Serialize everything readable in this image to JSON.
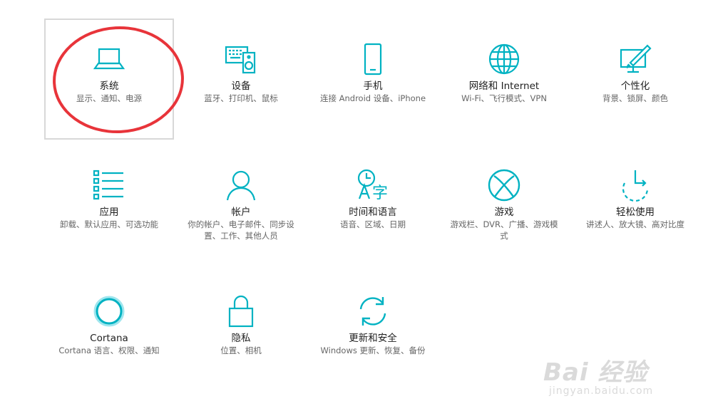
{
  "accent_color": "#00b2c2",
  "tiles": [
    {
      "name": "system",
      "icon": "laptop-icon",
      "label": "系统",
      "sub": "显示、通知、电源",
      "selected": true
    },
    {
      "name": "devices",
      "icon": "keyboard-speaker-icon",
      "label": "设备",
      "sub": "蓝牙、打印机、鼠标"
    },
    {
      "name": "phone",
      "icon": "phone-icon",
      "label": "手机",
      "sub": "连接 Android 设备、iPhone"
    },
    {
      "name": "network",
      "icon": "globe-icon",
      "label": "网络和 Internet",
      "sub": "Wi-Fi、飞行模式、VPN"
    },
    {
      "name": "personalization",
      "icon": "paint-brush-monitor-icon",
      "label": "个性化",
      "sub": "背景、锁屏、颜色"
    },
    {
      "name": "apps",
      "icon": "app-list-icon",
      "label": "应用",
      "sub": "卸载、默认应用、可选功能"
    },
    {
      "name": "accounts",
      "icon": "person-icon",
      "label": "帐户",
      "sub": "你的帐户、电子邮件、同步设置、工作、其他人员"
    },
    {
      "name": "time-language",
      "icon": "clock-language-icon",
      "label": "时间和语言",
      "sub": "语音、区域、日期"
    },
    {
      "name": "gaming",
      "icon": "xbox-icon",
      "label": "游戏",
      "sub": "游戏栏、DVR、广播、游戏模式"
    },
    {
      "name": "ease-of-access",
      "icon": "ease-of-access-icon",
      "label": "轻松使用",
      "sub": "讲述人、放大镜、高对比度"
    },
    {
      "name": "cortana",
      "icon": "cortana-ring-icon",
      "label": "Cortana",
      "sub": "Cortana 语言、权限、通知"
    },
    {
      "name": "privacy",
      "icon": "lock-icon",
      "label": "隐私",
      "sub": "位置、相机"
    },
    {
      "name": "update-security",
      "icon": "sync-arrows-icon",
      "label": "更新和安全",
      "sub": "Windows 更新、恢复、备份"
    }
  ],
  "watermark": {
    "brand": "Bai 经验",
    "url": "jingyan.baidu.com"
  }
}
